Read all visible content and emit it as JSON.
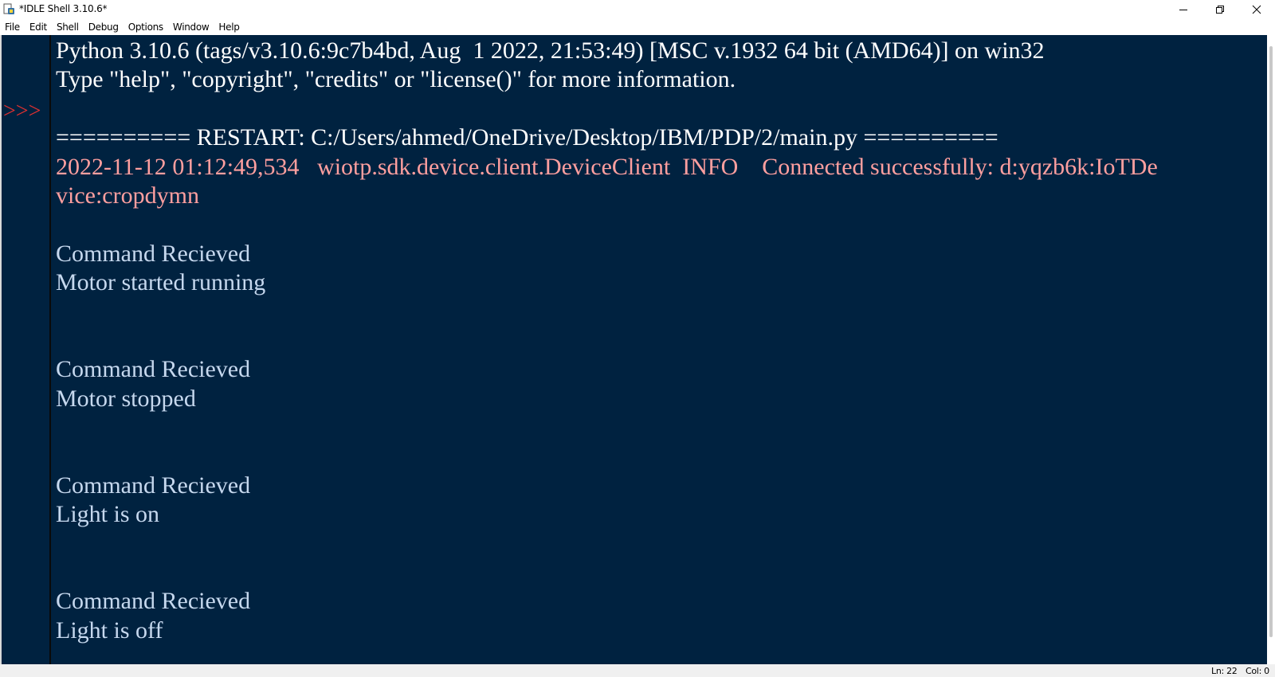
{
  "window": {
    "title": "*IDLE Shell 3.10.6*",
    "icon": "python-idle-icon"
  },
  "menu": [
    "File",
    "Edit",
    "Shell",
    "Debug",
    "Options",
    "Window",
    "Help"
  ],
  "shell": {
    "prompt": ">>>",
    "lines": [
      {
        "text": "Python 3.10.6 (tags/v3.10.6:9c7b4bd, Aug  1 2022, 21:53:49) [MSC v.1932 64 bit (AMD64)] on win32",
        "color": "white"
      },
      {
        "text": "Type \"help\", \"copyright\", \"credits\" or \"license()\" for more information.",
        "color": "white"
      },
      {
        "text": "",
        "color": "white"
      },
      {
        "text": "========== RESTART: C:/Users/ahmed/OneDrive/Desktop/IBM/PDP/2/main.py ==========",
        "color": "white"
      },
      {
        "text": "2022-11-12 01:12:49,534   wiotp.sdk.device.client.DeviceClient  INFO    Connected successfully: d:yqzb6k:IoTDe",
        "color": "pink"
      },
      {
        "text": "vice:cropdymn",
        "color": "pink"
      },
      {
        "text": "",
        "color": "blue"
      },
      {
        "text": "Command Recieved",
        "color": "blue"
      },
      {
        "text": "Motor started running",
        "color": "blue"
      },
      {
        "text": "",
        "color": "blue"
      },
      {
        "text": "",
        "color": "blue"
      },
      {
        "text": "Command Recieved",
        "color": "blue"
      },
      {
        "text": "Motor stopped",
        "color": "blue"
      },
      {
        "text": "",
        "color": "blue"
      },
      {
        "text": "",
        "color": "blue"
      },
      {
        "text": "Command Recieved",
        "color": "blue"
      },
      {
        "text": "Light is on",
        "color": "blue"
      },
      {
        "text": "",
        "color": "blue"
      },
      {
        "text": "",
        "color": "blue"
      },
      {
        "text": "Command Recieved",
        "color": "blue"
      },
      {
        "text": "Light is off",
        "color": "blue"
      }
    ]
  },
  "status": {
    "ln": "Ln: 22",
    "col": "Col: 0"
  },
  "colors": {
    "background": "#002240",
    "white": "#ffffff",
    "stderr": "#ff9f9f",
    "stdout": "#c6d8ee",
    "prompt": "#e03030"
  }
}
